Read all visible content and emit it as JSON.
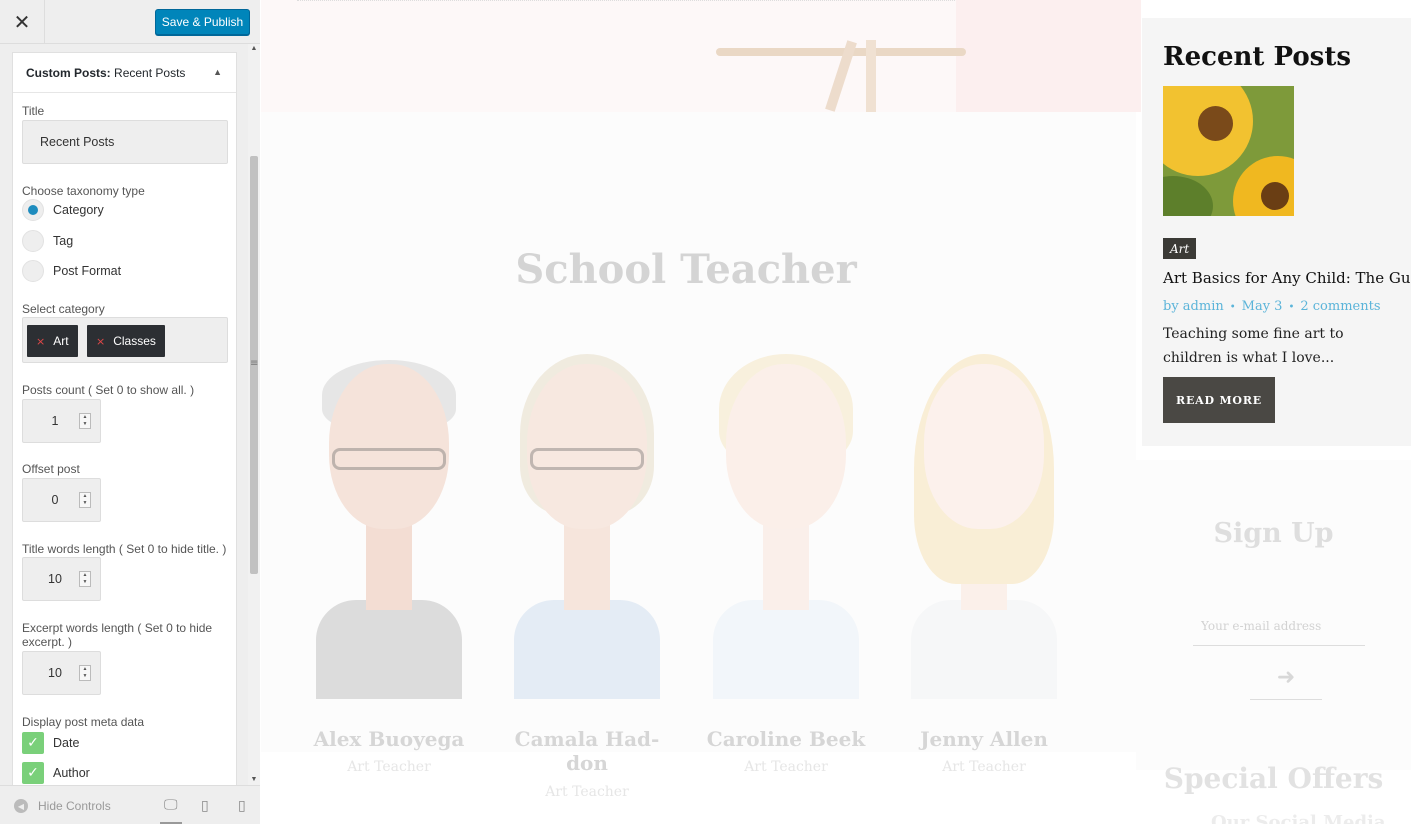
{
  "panel": {
    "close_icon": "close-icon",
    "publish_label": "Save & Publish",
    "section": {
      "title_prefix": "Custom Posts:",
      "title_name": "Recent Posts"
    },
    "fields": {
      "title_label": "Title",
      "title_value": "Recent Posts",
      "taxonomy_label": "Choose taxonomy type",
      "taxonomy_options": [
        "Category",
        "Tag",
        "Post Format"
      ],
      "taxonomy_selected": "Category",
      "category_label": "Select category",
      "categories": [
        "Art",
        "Classes"
      ],
      "chip_remove": "×",
      "posts_count_label": "Posts count ( Set 0 to show all. )",
      "posts_count": "1",
      "offset_label": "Offset post",
      "offset": "0",
      "title_words_label": "Title words length ( Set 0 to hide title. )",
      "title_words": "10",
      "excerpt_words_label": "Excerpt words length ( Set 0 to hide excerpt. )",
      "excerpt_words": "10",
      "meta_label": "Display post meta data",
      "meta_options": [
        "Date",
        "Author"
      ],
      "meta_checked": [
        true,
        true
      ]
    },
    "footer": {
      "hide_controls": "Hide Controls",
      "devices": [
        "desktop-icon",
        "tablet-icon",
        "mobile-icon"
      ],
      "active_device": "desktop"
    }
  },
  "preview": {
    "section_title": "School Teacher",
    "teachers": [
      {
        "name": "Alex Buoyega",
        "role": "Art Teacher"
      },
      {
        "name": "Camala Had-\ndon",
        "role": "Art Teacher"
      },
      {
        "name": "Caroline Beek",
        "role": "Art Teacher"
      },
      {
        "name": "Jenny Allen",
        "role": "Art Teacher"
      }
    ],
    "widget": {
      "title": "Recent Posts",
      "category_badge": "Art",
      "post_title": "Art Basics for Any Child: The Guide",
      "meta": {
        "by": "by admin",
        "date": "May 3",
        "comments": "2 comments"
      },
      "excerpt": "Teaching some fine art to children is what I love...",
      "read_more": "READ MORE"
    },
    "signup": {
      "title": "Sign Up",
      "email_placeholder": "Your e-mail address",
      "submit_icon": "arrow-right-icon"
    },
    "offers": {
      "title": "Special Offers",
      "subtitle": "Our Social Media"
    }
  },
  "colors": {
    "publish": "#0085ba",
    "radio_selected": "#1e8cbe",
    "chip_bg": "#2c2f33",
    "chip_x": "#e04848",
    "checkbox": "#7ad07a",
    "meta_link": "#5bb4d9",
    "read_more_bg": "#4a4844"
  }
}
